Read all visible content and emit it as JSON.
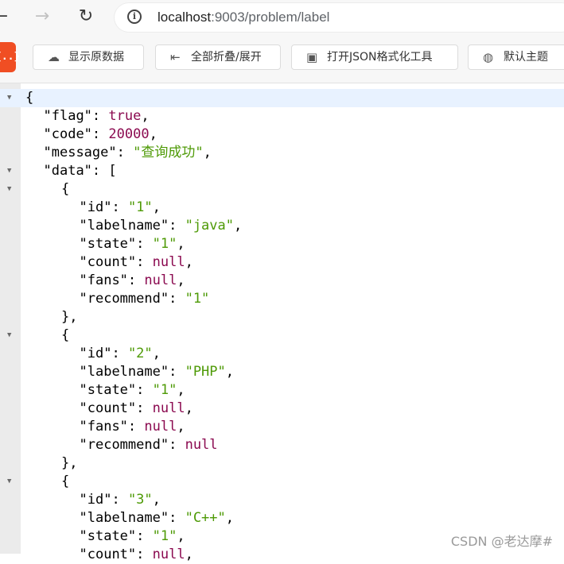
{
  "browser": {
    "back_icon": "back-arrow-icon",
    "forward_icon": "forward-arrow-icon",
    "reload_icon": "reload-icon",
    "info_icon": "info-icon",
    "url_host": "localhost",
    "url_rest": ":9003/problem/label"
  },
  "toolbar": {
    "extension_logo": "{..}",
    "show_raw_label": "显示原数据",
    "collapse_label": "全部折叠/展开",
    "open_formatter_label": "打开JSON格式化工具",
    "theme_label": "默认主题"
  },
  "json_lines": [
    {
      "indent": 0,
      "fold": true,
      "active": true,
      "parts": [
        {
          "t": "p",
          "v": "{"
        }
      ]
    },
    {
      "indent": 1,
      "parts": [
        {
          "t": "k",
          "v": "\"flag\""
        },
        {
          "t": "p",
          "v": ": "
        },
        {
          "t": "kw",
          "v": "true"
        },
        {
          "t": "p",
          "v": ","
        }
      ]
    },
    {
      "indent": 1,
      "parts": [
        {
          "t": "k",
          "v": "\"code\""
        },
        {
          "t": "p",
          "v": ": "
        },
        {
          "t": "n",
          "v": "20000"
        },
        {
          "t": "p",
          "v": ","
        }
      ]
    },
    {
      "indent": 1,
      "parts": [
        {
          "t": "k",
          "v": "\"message\""
        },
        {
          "t": "p",
          "v": ": "
        },
        {
          "t": "s",
          "v": "\"查询成功\""
        },
        {
          "t": "p",
          "v": ","
        }
      ]
    },
    {
      "indent": 1,
      "fold": true,
      "parts": [
        {
          "t": "k",
          "v": "\"data\""
        },
        {
          "t": "p",
          "v": ": ["
        }
      ]
    },
    {
      "indent": 2,
      "fold": true,
      "parts": [
        {
          "t": "p",
          "v": "{"
        }
      ]
    },
    {
      "indent": 3,
      "parts": [
        {
          "t": "k",
          "v": "\"id\""
        },
        {
          "t": "p",
          "v": ": "
        },
        {
          "t": "s",
          "v": "\"1\""
        },
        {
          "t": "p",
          "v": ","
        }
      ]
    },
    {
      "indent": 3,
      "parts": [
        {
          "t": "k",
          "v": "\"labelname\""
        },
        {
          "t": "p",
          "v": ": "
        },
        {
          "t": "s",
          "v": "\"java\""
        },
        {
          "t": "p",
          "v": ","
        }
      ]
    },
    {
      "indent": 3,
      "parts": [
        {
          "t": "k",
          "v": "\"state\""
        },
        {
          "t": "p",
          "v": ": "
        },
        {
          "t": "s",
          "v": "\"1\""
        },
        {
          "t": "p",
          "v": ","
        }
      ]
    },
    {
      "indent": 3,
      "parts": [
        {
          "t": "k",
          "v": "\"count\""
        },
        {
          "t": "p",
          "v": ": "
        },
        {
          "t": "kw",
          "v": "null"
        },
        {
          "t": "p",
          "v": ","
        }
      ]
    },
    {
      "indent": 3,
      "parts": [
        {
          "t": "k",
          "v": "\"fans\""
        },
        {
          "t": "p",
          "v": ": "
        },
        {
          "t": "kw",
          "v": "null"
        },
        {
          "t": "p",
          "v": ","
        }
      ]
    },
    {
      "indent": 3,
      "parts": [
        {
          "t": "k",
          "v": "\"recommend\""
        },
        {
          "t": "p",
          "v": ": "
        },
        {
          "t": "s",
          "v": "\"1\""
        }
      ]
    },
    {
      "indent": 2,
      "parts": [
        {
          "t": "p",
          "v": "},"
        }
      ]
    },
    {
      "indent": 2,
      "fold": true,
      "parts": [
        {
          "t": "p",
          "v": "{"
        }
      ]
    },
    {
      "indent": 3,
      "parts": [
        {
          "t": "k",
          "v": "\"id\""
        },
        {
          "t": "p",
          "v": ": "
        },
        {
          "t": "s",
          "v": "\"2\""
        },
        {
          "t": "p",
          "v": ","
        }
      ]
    },
    {
      "indent": 3,
      "parts": [
        {
          "t": "k",
          "v": "\"labelname\""
        },
        {
          "t": "p",
          "v": ": "
        },
        {
          "t": "s",
          "v": "\"PHP\""
        },
        {
          "t": "p",
          "v": ","
        }
      ]
    },
    {
      "indent": 3,
      "parts": [
        {
          "t": "k",
          "v": "\"state\""
        },
        {
          "t": "p",
          "v": ": "
        },
        {
          "t": "s",
          "v": "\"1\""
        },
        {
          "t": "p",
          "v": ","
        }
      ]
    },
    {
      "indent": 3,
      "parts": [
        {
          "t": "k",
          "v": "\"count\""
        },
        {
          "t": "p",
          "v": ": "
        },
        {
          "t": "kw",
          "v": "null"
        },
        {
          "t": "p",
          "v": ","
        }
      ]
    },
    {
      "indent": 3,
      "parts": [
        {
          "t": "k",
          "v": "\"fans\""
        },
        {
          "t": "p",
          "v": ": "
        },
        {
          "t": "kw",
          "v": "null"
        },
        {
          "t": "p",
          "v": ","
        }
      ]
    },
    {
      "indent": 3,
      "parts": [
        {
          "t": "k",
          "v": "\"recommend\""
        },
        {
          "t": "p",
          "v": ": "
        },
        {
          "t": "kw",
          "v": "null"
        }
      ]
    },
    {
      "indent": 2,
      "parts": [
        {
          "t": "p",
          "v": "},"
        }
      ]
    },
    {
      "indent": 2,
      "fold": true,
      "parts": [
        {
          "t": "p",
          "v": "{"
        }
      ]
    },
    {
      "indent": 3,
      "parts": [
        {
          "t": "k",
          "v": "\"id\""
        },
        {
          "t": "p",
          "v": ": "
        },
        {
          "t": "s",
          "v": "\"3\""
        },
        {
          "t": "p",
          "v": ","
        }
      ]
    },
    {
      "indent": 3,
      "parts": [
        {
          "t": "k",
          "v": "\"labelname\""
        },
        {
          "t": "p",
          "v": ": "
        },
        {
          "t": "s",
          "v": "\"C++\""
        },
        {
          "t": "p",
          "v": ","
        }
      ]
    },
    {
      "indent": 3,
      "parts": [
        {
          "t": "k",
          "v": "\"state\""
        },
        {
          "t": "p",
          "v": ": "
        },
        {
          "t": "s",
          "v": "\"1\""
        },
        {
          "t": "p",
          "v": ","
        }
      ]
    },
    {
      "indent": 3,
      "parts": [
        {
          "t": "k",
          "v": "\"count\""
        },
        {
          "t": "p",
          "v": ": "
        },
        {
          "t": "kw",
          "v": "null"
        },
        {
          "t": "p",
          "v": ","
        }
      ]
    }
  ],
  "watermark": "CSDN @老达摩#"
}
